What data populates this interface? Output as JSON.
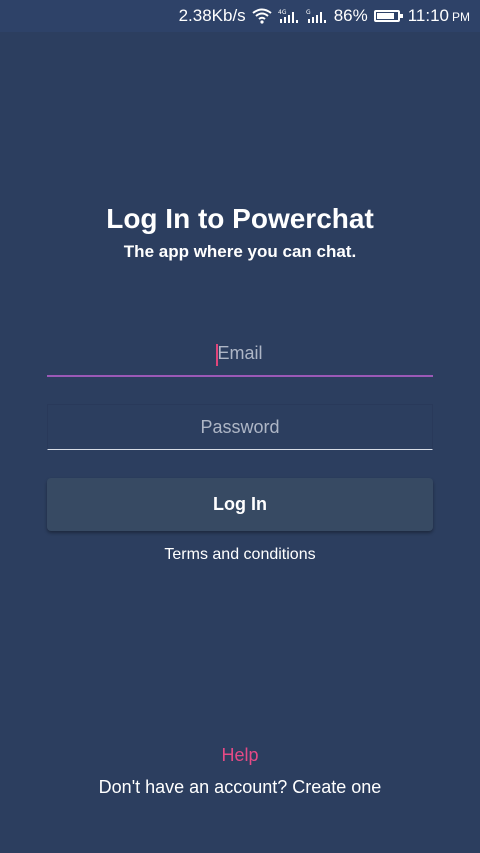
{
  "status_bar": {
    "network_speed": "2.38Kb/s",
    "signal1_label": "4G",
    "signal2_label": "G",
    "battery_percent": "86%",
    "battery_level": 0.86,
    "time": "11:10",
    "ampm": "PM"
  },
  "header": {
    "title": "Log In to Powerchat",
    "subtitle": "The app where you can chat."
  },
  "form": {
    "email_placeholder": "Email",
    "email_value": "",
    "password_placeholder": "Password",
    "password_value": "",
    "login_label": "Log In"
  },
  "links": {
    "terms": "Terms and conditions",
    "help": "Help",
    "signup": "Don't have an account? Create one"
  },
  "colors": {
    "background": "#2c3e5f",
    "status_bar": "#2e4268",
    "accent_underline": "#9b59b6",
    "help_link": "#e54a86",
    "button": "#374a63"
  }
}
